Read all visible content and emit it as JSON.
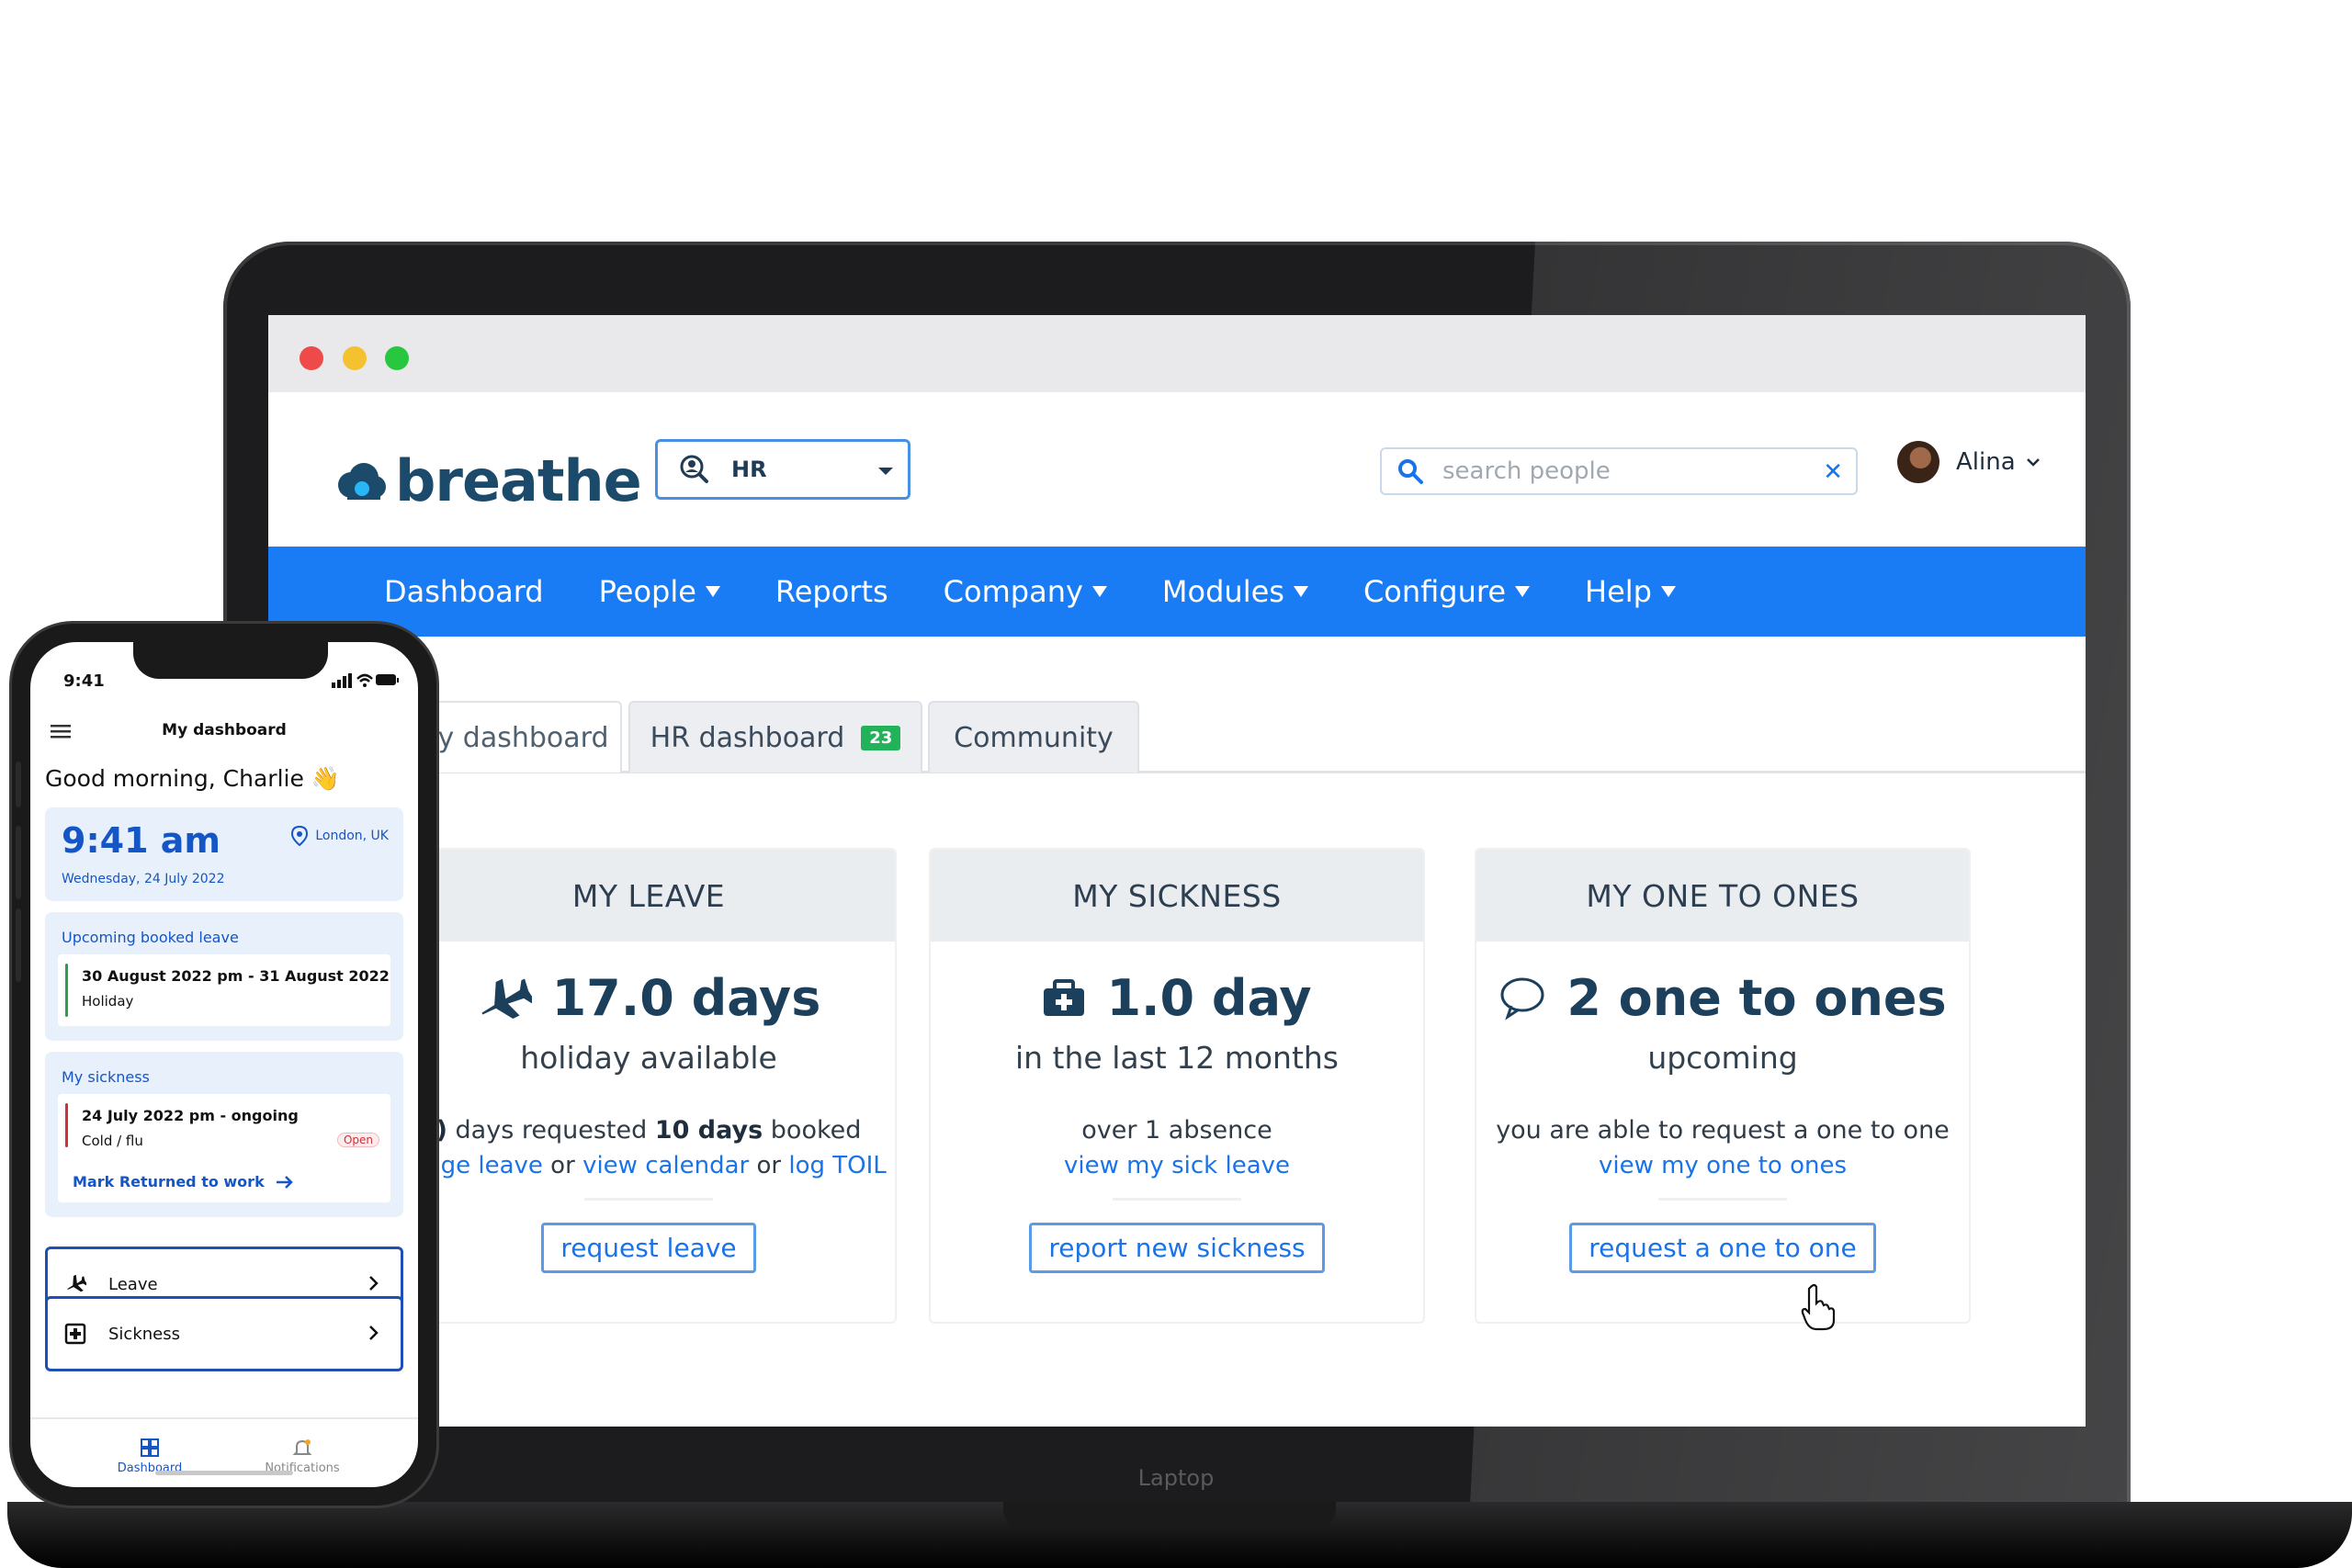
{
  "browser": {
    "controls": [
      "close",
      "minimize",
      "maximize"
    ]
  },
  "app": {
    "logo_text": "breathe",
    "module_select": {
      "value": "HR"
    },
    "search": {
      "placeholder": "search people",
      "clear_icon": "close-icon"
    },
    "user": {
      "name": "Alina"
    }
  },
  "nav": {
    "items": [
      {
        "label": "Dashboard",
        "dropdown": false
      },
      {
        "label": "People",
        "dropdown": true
      },
      {
        "label": "Reports",
        "dropdown": false
      },
      {
        "label": "Company",
        "dropdown": true
      },
      {
        "label": "Modules",
        "dropdown": true
      },
      {
        "label": "Configure",
        "dropdown": true
      },
      {
        "label": "Help",
        "dropdown": true
      }
    ]
  },
  "tabs": {
    "my_dashboard": "y dashboard",
    "hr_dashboard": "HR dashboard",
    "hr_badge": "23",
    "community": "Community"
  },
  "cards": {
    "leave": {
      "title": "MY LEAVE",
      "big": "17.0 days",
      "sub": "holiday available",
      "requested_num": ")",
      "requested_text": " days requested ",
      "booked_num": "10 days",
      "booked_text": " booked",
      "link1": "nage leave",
      "or1": " or ",
      "link2": "view calendar",
      "or2": " or ",
      "link3": "log TOIL",
      "button": "request leave"
    },
    "sickness": {
      "title": "MY SICKNESS",
      "big": "1.0 day",
      "sub": "in the last 12 months",
      "line": "over 1 absence",
      "link": "view my sick leave",
      "button": "report new sickness"
    },
    "one_to_ones": {
      "title": "MY ONE TO ONES",
      "big": "2 one to ones",
      "sub": "upcoming",
      "line": "you are able to request a one to one",
      "link": "view my one to ones",
      "button": "request a one to one"
    }
  },
  "laptop_label": "Laptop",
  "phone": {
    "status_time": "9:41",
    "title": "My dashboard",
    "greeting": "Good morning, Charlie 👋",
    "clock": {
      "time": "9:41 am",
      "date": "Wednesday, 24 July 2022",
      "location": "London, UK"
    },
    "upcoming": {
      "heading": "Upcoming booked leave",
      "dates": "30 August 2022 pm - 31 August 2022",
      "type": "Holiday"
    },
    "sickness": {
      "heading": "My sickness",
      "dates": "24 July 2022 pm - ongoing",
      "type": "Cold / flu",
      "status": "Open",
      "action": "Mark Returned to work"
    },
    "rows": {
      "leave": "Leave",
      "sickness": "Sickness"
    },
    "tabbar": {
      "dashboard": "Dashboard",
      "notifications": "Notifications"
    }
  },
  "colors": {
    "nav_blue": "#1a7cf5",
    "link_blue": "#1a73e8",
    "brand_navy": "#1c4a6b",
    "badge_green": "#22b35a",
    "phone_accent": "#1556c7",
    "leave_bar": "#2e9e4f",
    "sick_bar": "#d0303a"
  }
}
